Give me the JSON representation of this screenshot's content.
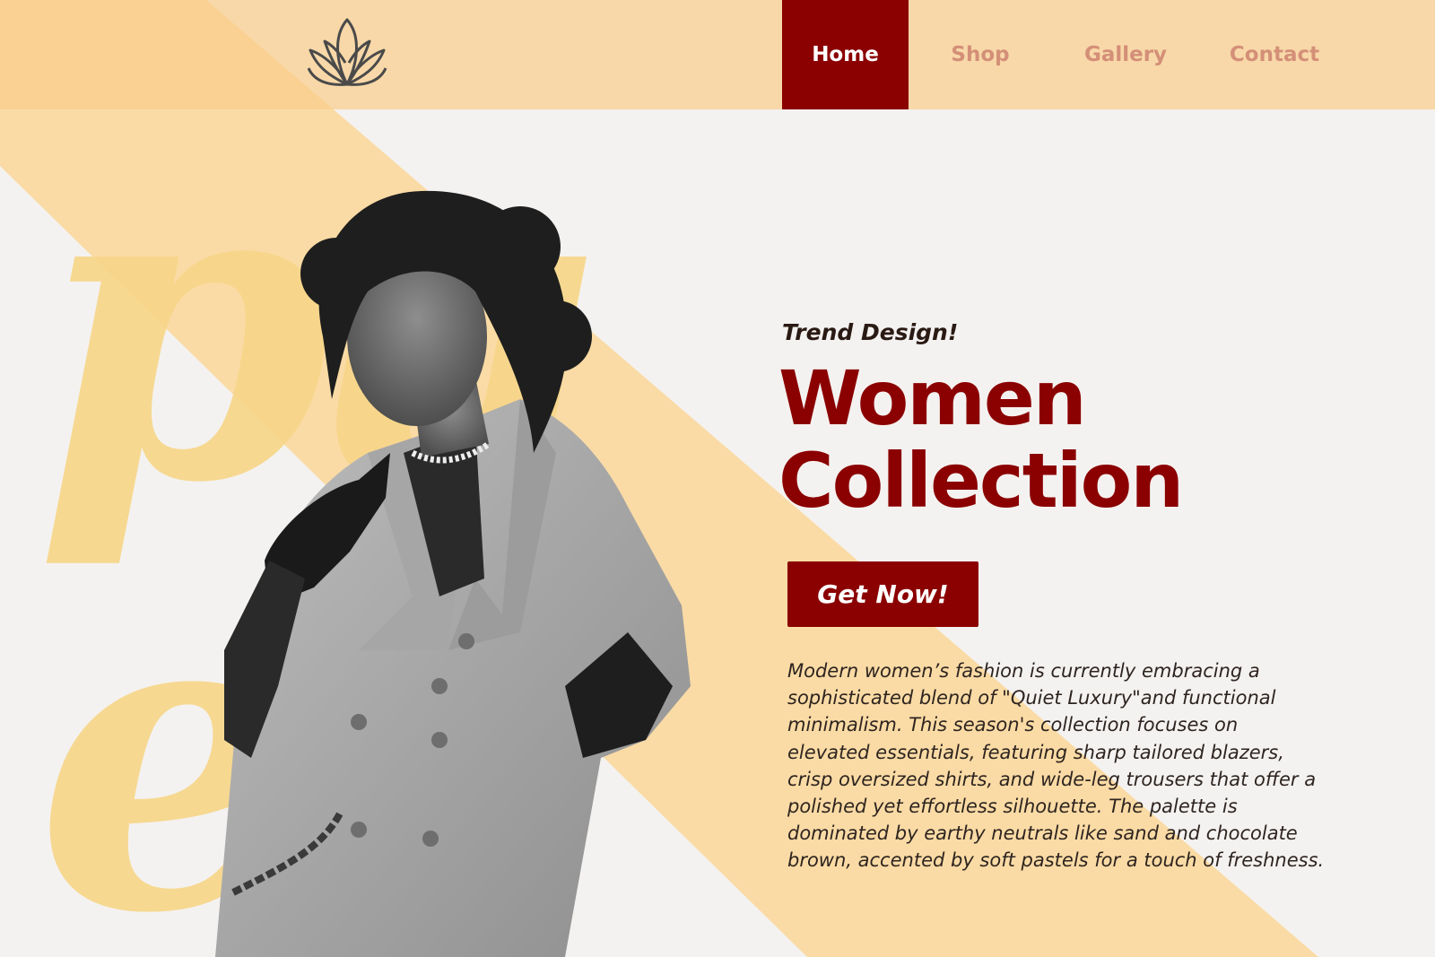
{
  "colors": {
    "accent": "#8B0000",
    "header_bg": "#FAD09A",
    "nav_inactive": "#D48F78",
    "background": "#F4F2F0",
    "band": "#FAD9A0",
    "deco_letters": "#F7D68A"
  },
  "header": {
    "logo_icon": "lotus-icon",
    "nav": [
      {
        "label": "Home",
        "active": true
      },
      {
        "label": "Shop",
        "active": false
      },
      {
        "label": "Gallery",
        "active": false
      },
      {
        "label": "Contact",
        "active": false
      }
    ]
  },
  "decor": {
    "top_letters": "pu",
    "bottom_letters": "ed"
  },
  "hero": {
    "tagline": "Trend Design!",
    "title_line1": "Women",
    "title_line2": "Collection",
    "cta_label": "Get Now!",
    "description": "Modern women’s fashion is currently embracing a sophisticated blend of \"Quiet Luxury\"and functional minimalism. This season's collection focuses on elevated essentials, featuring sharp tailored blazers, crisp oversized shirts, and wide-leg trousers that offer a polished yet effortless silhouette. The palette is dominated by earthy neutrals like sand and chocolate brown, accented by soft pastels for a touch of freshness.",
    "photo": "model-photo"
  }
}
